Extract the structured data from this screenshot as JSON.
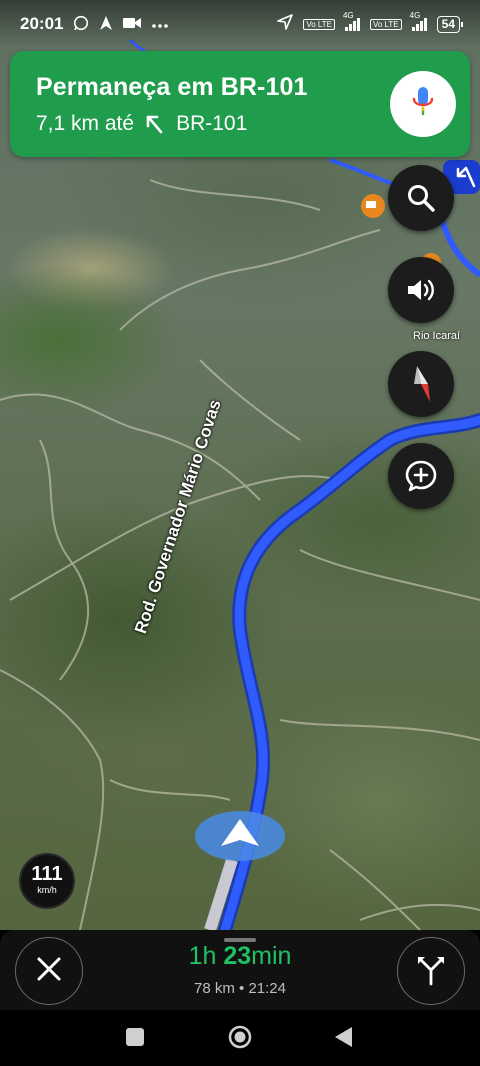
{
  "status_bar": {
    "time": "20:01",
    "icons": [
      "whatsapp-icon",
      "navigation-icon",
      "video-camera-icon",
      "more-dots-icon"
    ],
    "right_icons": [
      "location-arrow-icon",
      "volte-icon",
      "signal-4g-icon",
      "volte-icon",
      "signal-4g-icon"
    ],
    "volte": "Vo LTE",
    "network": "4G",
    "battery": "54"
  },
  "instruction": {
    "title": "Permaneça em BR-101",
    "distance": "7,1 km até",
    "road": "BR-101",
    "turn_icon": "turn-slight-left-icon",
    "mic_icon": "microphone-icon"
  },
  "controls": {
    "search_icon": "search-icon",
    "sound_icon": "volume-icon",
    "compass_icon": "compass-icon",
    "report_icon": "add-report-icon"
  },
  "map": {
    "place_label": "Rio Icaraí",
    "road_label": "Rod. Governador Mário Covas"
  },
  "speed": {
    "value": "111",
    "unit": "km/h"
  },
  "trip": {
    "hours": "1h",
    "minutes": "23",
    "min_unit": "min",
    "distance": "78 km",
    "separator": "•",
    "arrival": "21:24"
  },
  "colors": {
    "banner": "#1f9d4c",
    "route": "#2f5bff",
    "eta": "#21c063"
  }
}
